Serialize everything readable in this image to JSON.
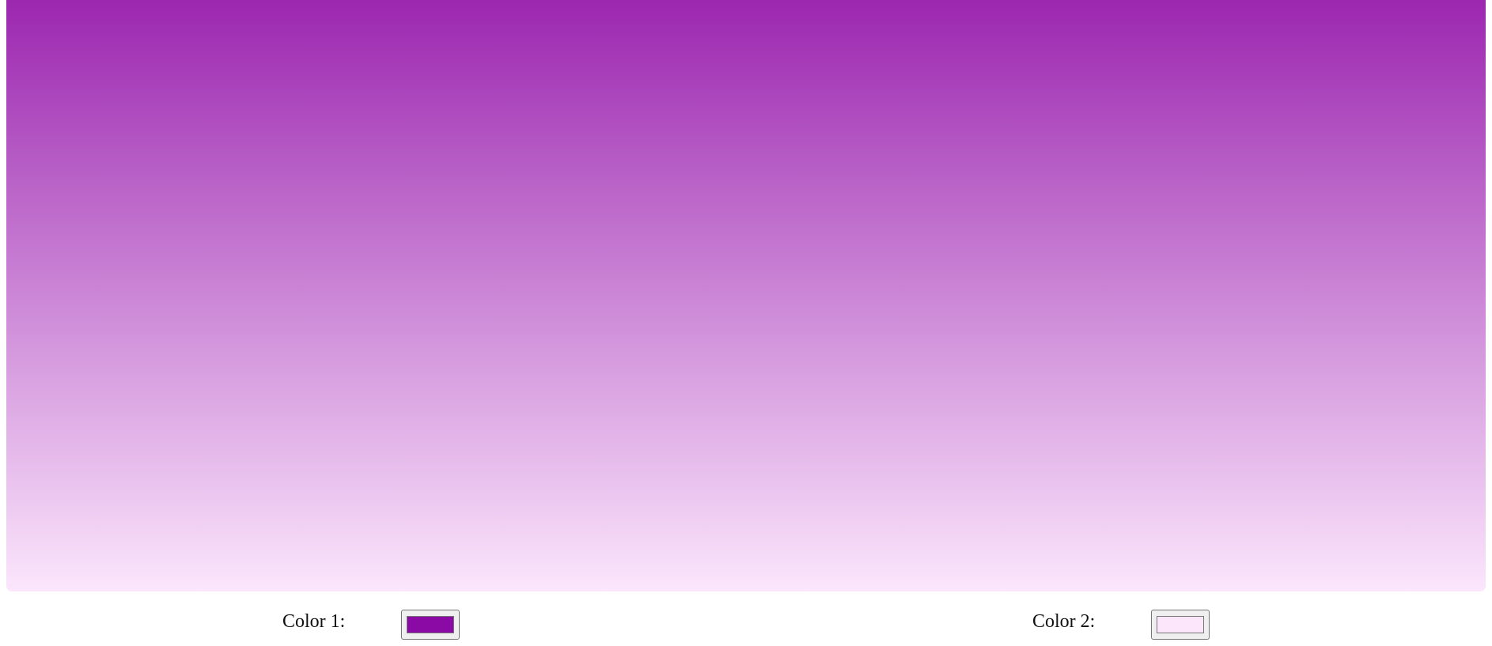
{
  "gradient": {
    "color_top": "#9c27b0",
    "color_bottom": "#fbe6fc"
  },
  "controls": {
    "color1": {
      "label": "Color 1:",
      "value": "#8b0aa5"
    },
    "color2": {
      "label": "Color 2:",
      "value": "#fbe6fc"
    }
  }
}
